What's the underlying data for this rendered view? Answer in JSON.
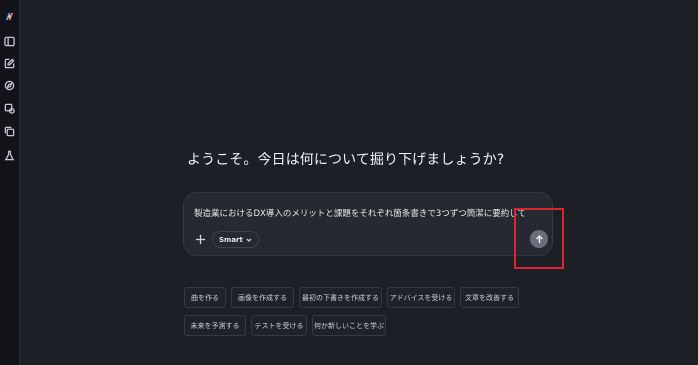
{
  "sidebar": {
    "icons": [
      "copilot-logo-icon",
      "sidebar-toggle-icon",
      "new-chat-icon",
      "discover-icon",
      "image-icon",
      "pages-icon",
      "labs-icon"
    ]
  },
  "main": {
    "greeting": "ようこそ。今日は何について掘り下げましょうか?",
    "composer": {
      "text": "製造業におけるDX導入のメリットと課題をそれぞれ箇条書きで3つずつ簡潔に要約して",
      "mode_label": "Smart"
    },
    "suggestions": [
      "曲を作る",
      "画像を作成する",
      "最初の下書きを作成する",
      "アドバイスを受ける",
      "文章を改善する",
      "未来を予測する",
      "テストを受ける",
      "何か新しいことを学ぶ"
    ]
  },
  "colors": {
    "background": "#1c1f26",
    "sidebar": "#121419",
    "composer": "#262932",
    "send_button": "#6a6e7a",
    "highlight": "#d8262c"
  }
}
